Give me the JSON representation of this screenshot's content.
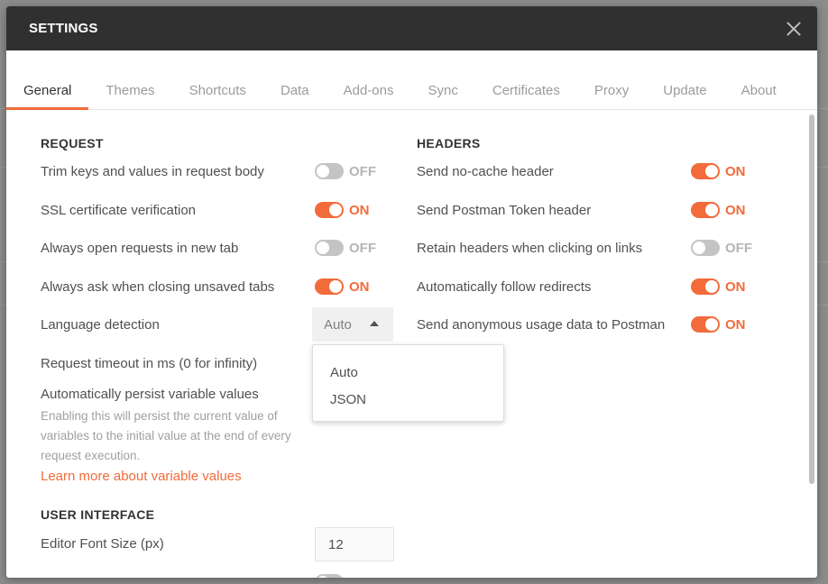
{
  "modal": {
    "title": "SETTINGS"
  },
  "tabs": [
    "General",
    "Themes",
    "Shortcuts",
    "Data",
    "Add-ons",
    "Sync",
    "Certificates",
    "Proxy",
    "Update",
    "About"
  ],
  "active_tab": "General",
  "request": {
    "heading": "REQUEST",
    "trim_keys": {
      "label": "Trim keys and values in request body",
      "state": "OFF"
    },
    "ssl": {
      "label": "SSL certificate verification",
      "state": "ON"
    },
    "new_tab": {
      "label": "Always open requests in new tab",
      "state": "OFF"
    },
    "ask_close": {
      "label": "Always ask when closing unsaved tabs",
      "state": "ON"
    },
    "language": {
      "label": "Language detection",
      "value": "Auto",
      "options": [
        "Auto",
        "JSON"
      ]
    },
    "timeout": {
      "label": "Request timeout in ms (0 for infinity)"
    },
    "persist": {
      "label": "Automatically persist variable values",
      "help": "Enabling this will persist the current value of variables to the initial value at the end of every request execution.",
      "link": "Learn more about variable values"
    }
  },
  "headers": {
    "heading": "HEADERS",
    "no_cache": {
      "label": "Send no-cache header",
      "state": "ON"
    },
    "token": {
      "label": "Send Postman Token header",
      "state": "ON"
    },
    "retain": {
      "label": "Retain headers when clicking on links",
      "state": "OFF"
    },
    "redirects": {
      "label": "Automatically follow redirects",
      "state": "ON"
    },
    "anonymous": {
      "label": "Send anonymous usage data to Postman",
      "state": "ON"
    }
  },
  "ui": {
    "heading": "USER INTERFACE",
    "font_size": {
      "label": "Editor Font Size (px)",
      "value": "12"
    }
  },
  "colors": {
    "accent": "#f26b3a",
    "header_bg": "#303030",
    "toggle_off": "#c4c4c4"
  }
}
